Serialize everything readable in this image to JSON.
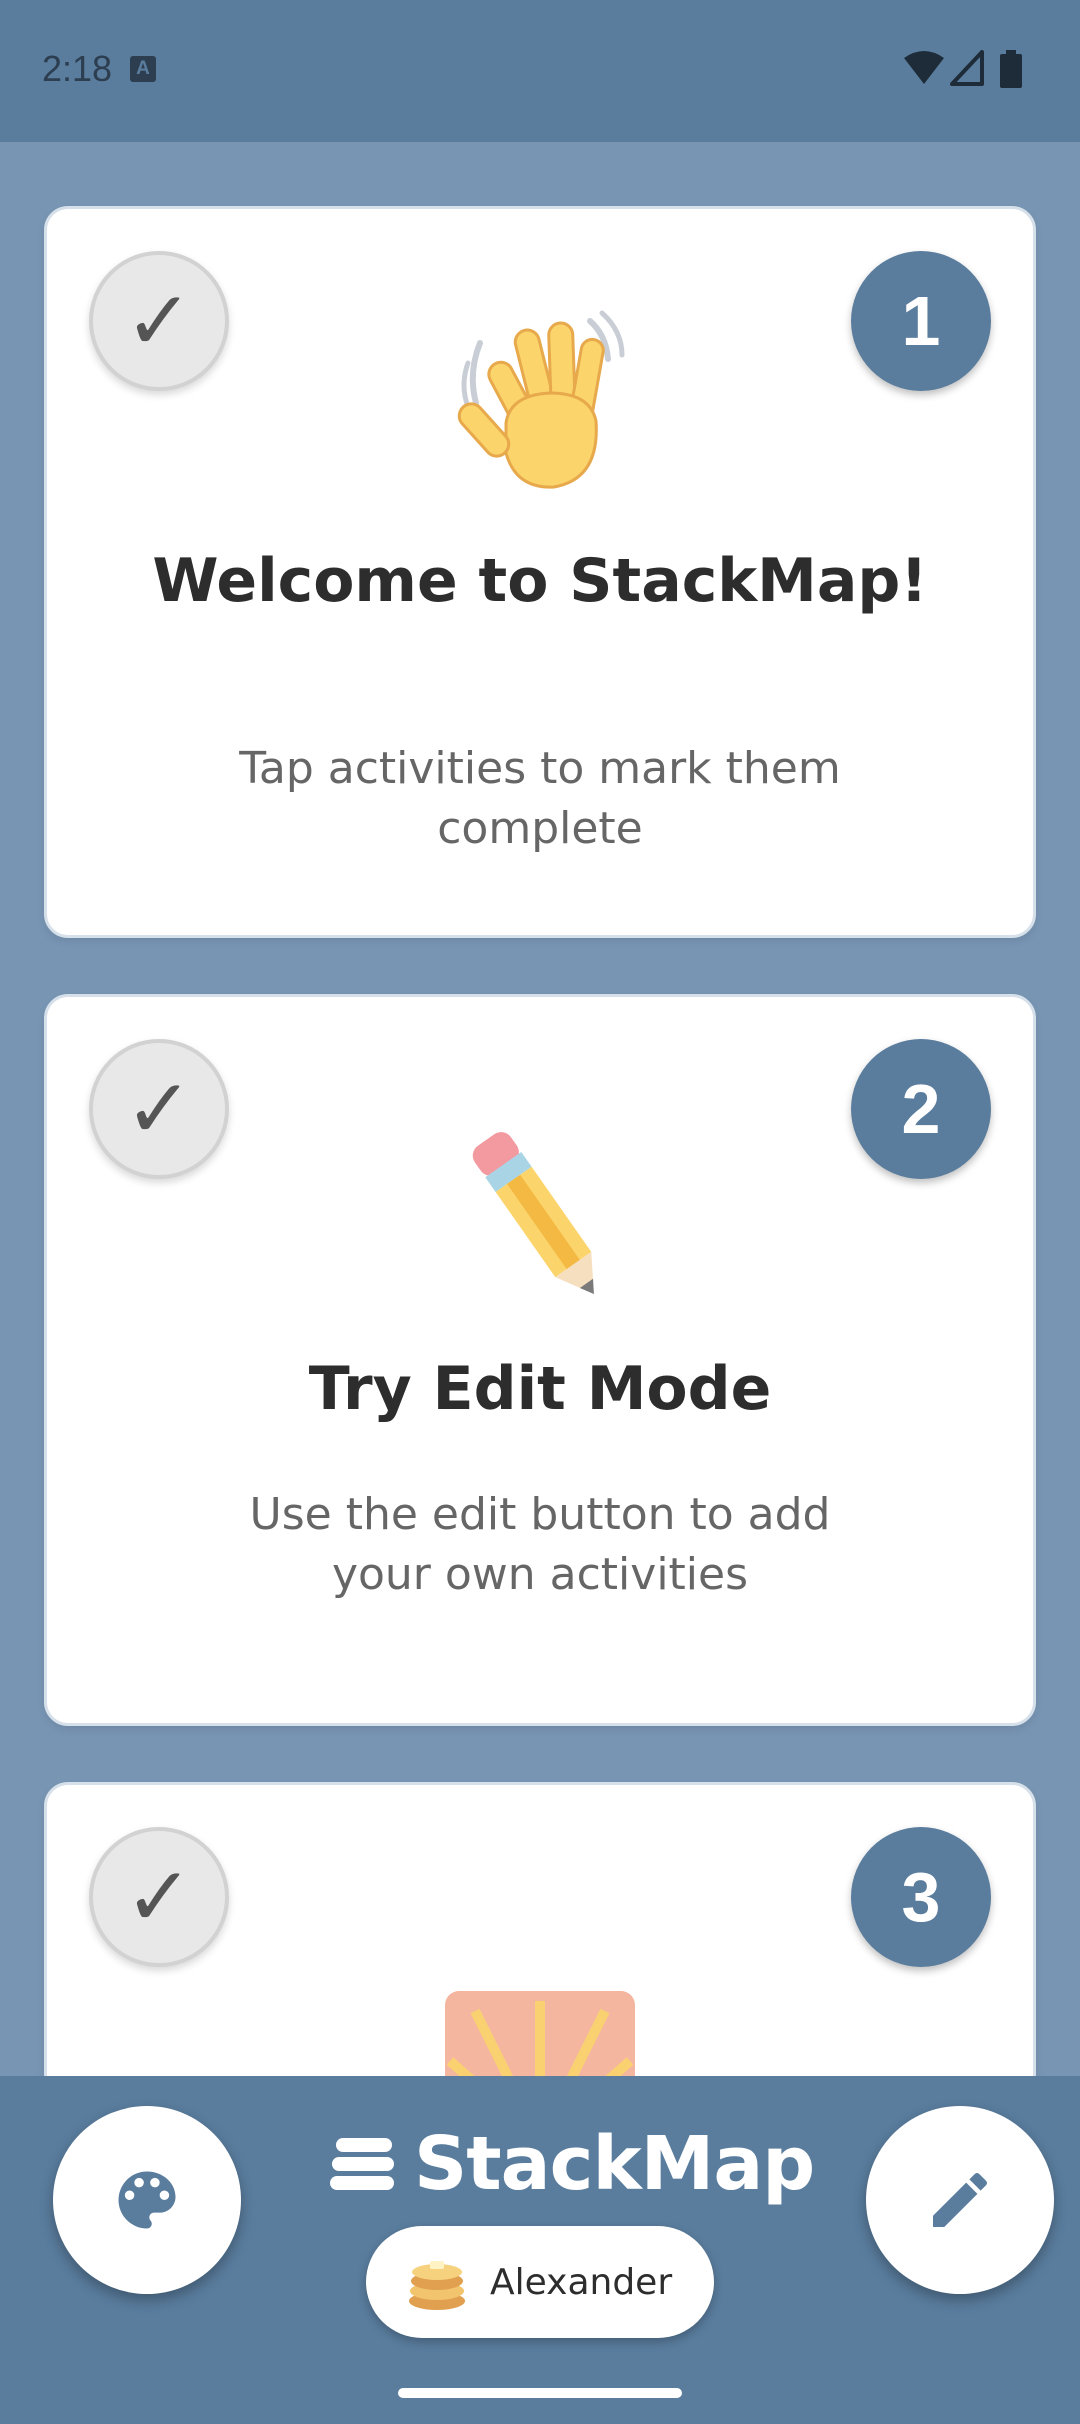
{
  "status_bar": {
    "time": "2:18",
    "notification_icon": "a-icon",
    "icons": [
      "wifi-icon",
      "signal-icon",
      "battery-icon"
    ]
  },
  "cards": [
    {
      "number": "1",
      "check": "✓",
      "emoji": "waving-hand-icon",
      "title": "Welcome to StackMap!",
      "description": "Tap activities to mark them complete"
    },
    {
      "number": "2",
      "check": "✓",
      "emoji": "pencil-icon",
      "title": "Try Edit Mode",
      "description": "Use the edit button to add your own activities"
    },
    {
      "number": "3",
      "check": "✓",
      "emoji": "sunrise-icon"
    }
  ],
  "bottom_bar": {
    "brand": "StackMap",
    "user_name": "Alexander",
    "left_button_icon": "palette-icon",
    "right_button_icon": "edit-pencil-icon"
  },
  "colors": {
    "background": "#7895b4",
    "bars": "#5a7d9e",
    "card": "#ffffff"
  }
}
